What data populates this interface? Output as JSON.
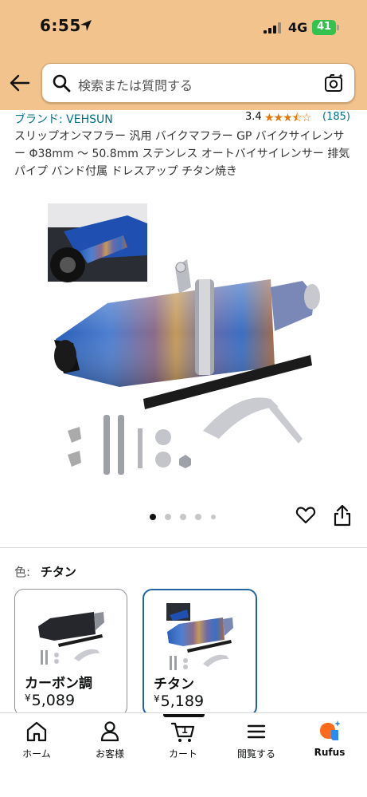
{
  "status_bar": {
    "time": "6:55",
    "network": "4G",
    "battery": "41"
  },
  "search": {
    "placeholder": "検索または質問する"
  },
  "product": {
    "brand": "ブランド: VEHSUN",
    "rating": "3.4",
    "stars": "★★★⯪☆",
    "rating_count": "(185)",
    "title": "スリップオンマフラー 汎用 バイクマフラー GP バイクサイレンサー Φ38mm 〜 50.8mm ステンレス オートバイサイレンサー 排気パイプ バンド付属 ドレスアップ チタン焼き"
  },
  "gallery": {
    "total_images": 5,
    "current_index": 1
  },
  "color_selector": {
    "label": "色:",
    "selected": "チタン"
  },
  "variants": [
    {
      "name": "カーボン調",
      "currency": "¥",
      "price": "5,089",
      "selected": false
    },
    {
      "name": "チタン",
      "currency": "¥",
      "price": "5,189",
      "selected": true
    }
  ],
  "nav": {
    "items": [
      {
        "label": "ホーム",
        "icon": "home-icon"
      },
      {
        "label": "お客様",
        "icon": "account-icon"
      },
      {
        "label": "カート",
        "icon": "cart-icon",
        "badge": "1"
      },
      {
        "label": "閲覧する",
        "icon": "menu-icon"
      },
      {
        "label": "Rufus",
        "icon": "rufus-icon"
      }
    ]
  },
  "colors": {
    "header_bg": "#f2c38c",
    "link": "#007185",
    "star": "#e77600",
    "selected_border": "#2162a1"
  }
}
